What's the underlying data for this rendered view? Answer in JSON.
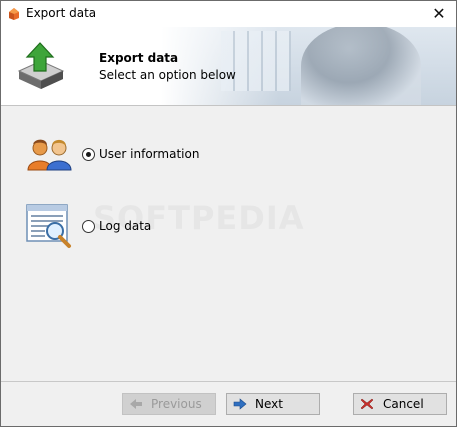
{
  "window": {
    "title": "Export data"
  },
  "header": {
    "title": "Export data",
    "subtitle": "Select an option below"
  },
  "options": [
    {
      "label": "User information",
      "selected": true,
      "icon": "users-icon"
    },
    {
      "label": "Log data",
      "selected": false,
      "icon": "log-search-icon"
    }
  ],
  "watermark": "SOFTPEDIA",
  "buttons": {
    "previous": "Previous",
    "next": "Next",
    "cancel": "Cancel"
  },
  "colors": {
    "accent_blue": "#2f6fc0",
    "cancel_red": "#c8302c",
    "green_arrow": "#3ea53a"
  }
}
